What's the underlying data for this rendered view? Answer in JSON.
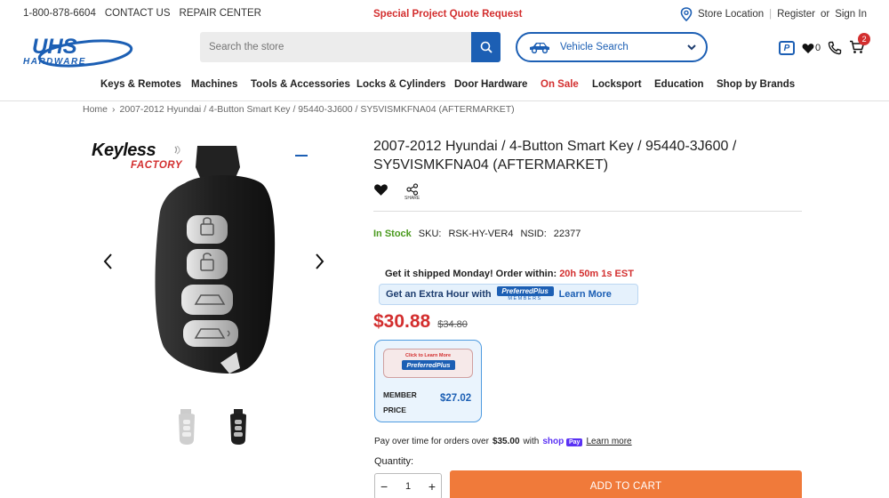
{
  "topbar": {
    "phone": "1-800-878-6604",
    "contact": "CONTACT US",
    "repair": "REPAIR CENTER",
    "promo": "Special Project Quote Request",
    "store_location": "Store Location",
    "register": "Register",
    "or": "or",
    "sign_in": "Sign In"
  },
  "header": {
    "logo_top": "UHS",
    "logo_bottom": "HARDWARE",
    "search_placeholder": "Search the store",
    "vehicle_search": "Vehicle Search",
    "pp_icon": "P",
    "wishlist_count": "0",
    "cart_count": "2"
  },
  "nav": [
    "Keys & Remotes",
    "Machines",
    "Tools & Accessories",
    "Locks & Cylinders",
    "Door Hardware",
    "On Sale",
    "Locksport",
    "Education",
    "Shop by Brands"
  ],
  "breadcrumb": {
    "home": "Home",
    "sep": "›",
    "current": "2007-2012 Hyundai / 4-Button Smart Key / 95440-3J600 / SY5VISMKFNA04 (AFTERMARKET)"
  },
  "gallery": {
    "brand_top": "Keyless",
    "brand_bottom": "FACTORY"
  },
  "product": {
    "title": "2007-2012 Hyundai / 4-Button Smart Key / 95440-3J600 / SY5VISMKFNA04 (AFTERMARKET)",
    "share_label": "SHARE",
    "stock": "In Stock",
    "sku_label": "SKU:",
    "sku": "RSK-HY-VER4",
    "nsid_label": "NSID:",
    "nsid": "22377",
    "ship_text": "Get it shipped Monday! Order within:",
    "ship_time": "20h 50m 1s EST",
    "extra_hour": "Get an Extra Hour with",
    "preferred_top": "PreferredPlus",
    "preferred_bottom": "MEMBERS",
    "learn_more": "Learn More",
    "price": "$30.88",
    "old_price": "$34.80",
    "member_card_top": "Click to Learn More",
    "member_card_logo": "PreferredPlus",
    "member_label": "MEMBER PRICE",
    "member_price": "$27.02",
    "pay_over": "Pay over time for orders over",
    "pay_amount": "$35.00",
    "pay_with": "with",
    "shop": "shop",
    "pay": "Pay",
    "pay_learn": "Learn more",
    "qty_label": "Quantity:",
    "qty": "1",
    "minus": "−",
    "plus": "+",
    "add_to_cart": "ADD TO CART"
  },
  "colors": {
    "primary": "#1c5fb4",
    "sale_red": "#d32f2f",
    "in_stock": "#4a9a1e",
    "add_to_cart": "#f07a3a"
  }
}
